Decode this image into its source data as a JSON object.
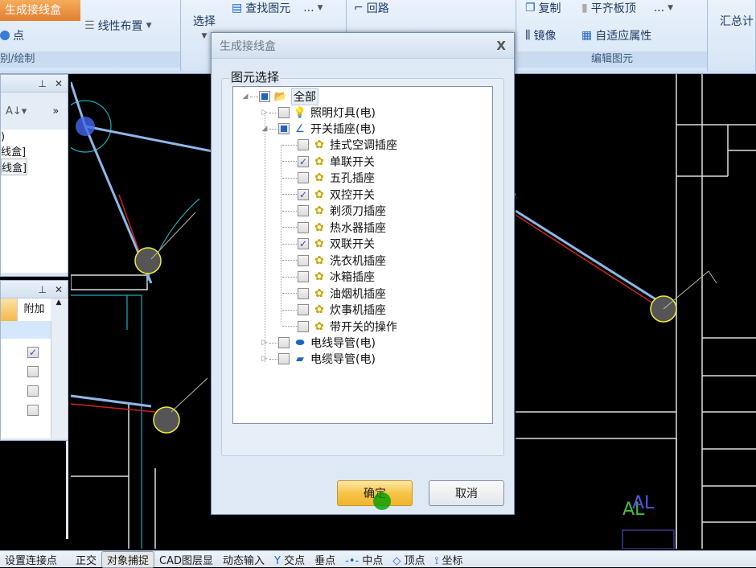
{
  "ribbon": {
    "orange_button": "生成接线盒",
    "point_label": "点",
    "linear_layout": "线性布置",
    "group_identify_draw": "别/绘制",
    "select_label": "选择",
    "find_element": "查找图元",
    "more": "...",
    "loop": "回路",
    "copy": "复制",
    "align_top": "平齐板顶",
    "mirror": "镜像",
    "adaptive_props": "自适应属性",
    "group_edit_element": "编辑图元",
    "summary_calc": "汇总计"
  },
  "left_panel": {
    "items": [
      ")",
      "线盒]",
      "线盒]"
    ],
    "table_header_extra": "附加",
    "table_checks": [
      true,
      false,
      false,
      false
    ]
  },
  "dialog": {
    "title": "生成接线盒",
    "close": "X",
    "group_title": "图元选择",
    "tree": {
      "root": {
        "label": "全部",
        "state": "partial"
      },
      "nodes": [
        {
          "label": "照明灯具(电)",
          "state": "unchecked",
          "icon": "lightbulb-icon",
          "expanded": false
        },
        {
          "label": "开关插座(电)",
          "state": "partial",
          "icon": "switch-icon",
          "expanded": true,
          "children": [
            {
              "label": "挂式空调插座",
              "checked": false
            },
            {
              "label": "单联开关",
              "checked": true
            },
            {
              "label": "五孔插座",
              "checked": false
            },
            {
              "label": "双控开关",
              "checked": true
            },
            {
              "label": "剃须刀插座",
              "checked": false
            },
            {
              "label": "热水器插座",
              "checked": false
            },
            {
              "label": "双联开关",
              "checked": true
            },
            {
              "label": "洗衣机插座",
              "checked": false
            },
            {
              "label": "冰箱插座",
              "checked": false
            },
            {
              "label": "油烟机插座",
              "checked": false
            },
            {
              "label": "炊事机插座",
              "checked": false
            },
            {
              "label": "带开关的操作",
              "checked": false
            }
          ]
        },
        {
          "label": "电线导管(电)",
          "state": "unchecked",
          "icon": "wire-conduit-icon",
          "expanded": false
        },
        {
          "label": "电缆导管(电)",
          "state": "unchecked",
          "icon": "cable-conduit-icon",
          "expanded": false
        }
      ]
    },
    "ok": "确定",
    "cancel": "取消"
  },
  "statusbar": {
    "left_text": "设置连接点",
    "items": [
      "正交",
      "对象捕捉",
      "CAD图层显",
      "动态输入",
      "交点",
      "垂点",
      "中点",
      "顶点",
      "坐标"
    ],
    "active": "对象捕捉"
  },
  "cad": {
    "label_text": "AL"
  }
}
